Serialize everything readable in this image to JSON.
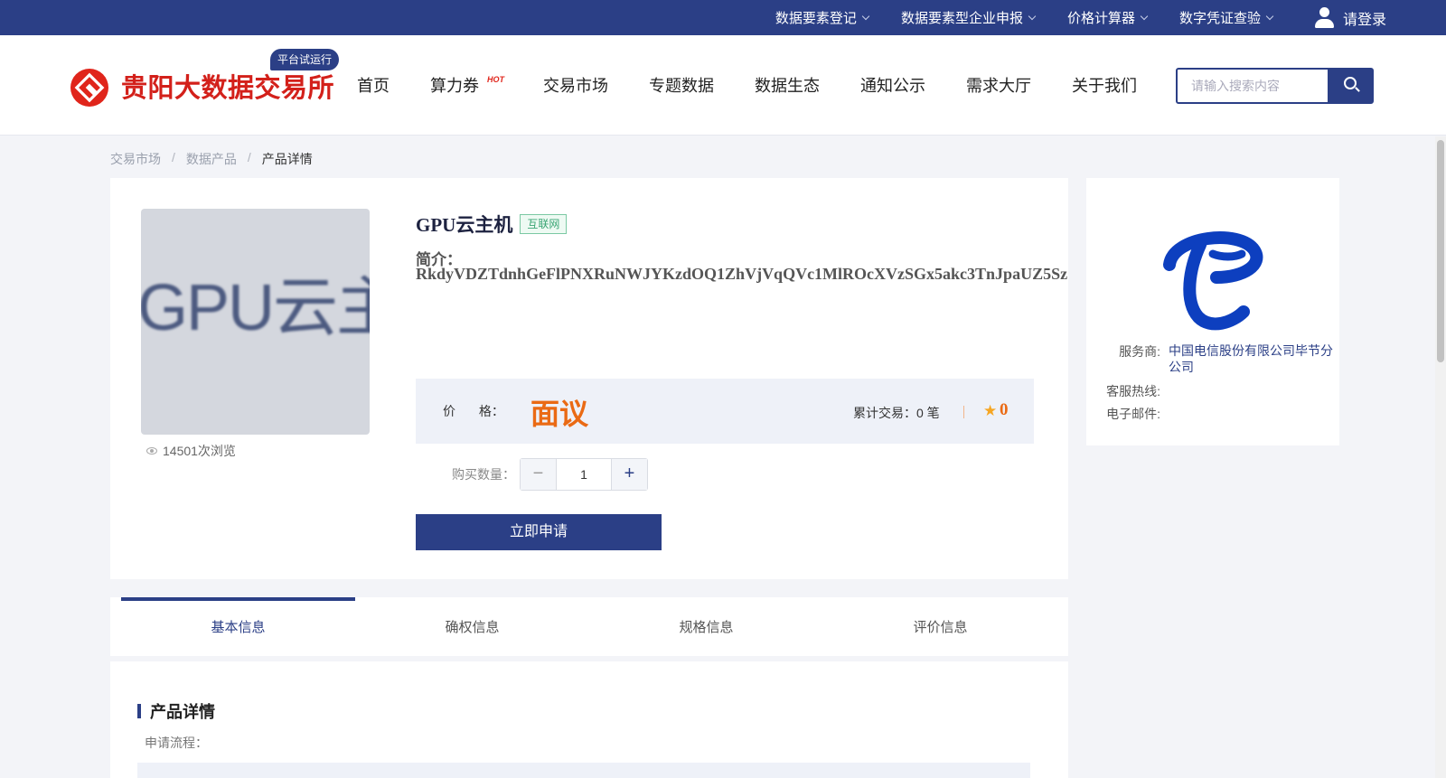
{
  "topbar": {
    "links": [
      "数据要素登记",
      "数据要素型企业申报",
      "价格计算器",
      "数字凭证查验"
    ],
    "login": "请登录"
  },
  "header": {
    "logo_text": "贵阳大数据交易所",
    "trial_badge": "平台试运行",
    "nav": [
      "首页",
      "算力券",
      "交易市场",
      "专题数据",
      "数据生态",
      "通知公示",
      "需求大厅",
      "关于我们"
    ],
    "hot_tag": "HOT",
    "search_placeholder": "请输入搜索内容"
  },
  "breadcrumb": [
    "交易市场",
    "数据产品",
    "产品详情"
  ],
  "product": {
    "image_text": "GPU云主机",
    "views": "14501次浏览",
    "title": "GPU云主机",
    "tag": "互联网",
    "intro_label": "简介：",
    "intro_text": "RkdyVDZTdnhGeFlPNXRuNWJYKzdOQ1ZhVjVqQVc1MlROcXVzSGx5akc3TnJpaUZ5Sz",
    "price_label": "价 格：",
    "price_value": "面议",
    "trade_count": "累计交易：0 笔",
    "rating": "0",
    "qty_label": "购买数量：",
    "qty_value": "1",
    "apply_button": "立即申请"
  },
  "provider": {
    "service_label": "服务商:",
    "service_value": "中国电信股份有限公司毕节分公司",
    "hotline_label": "客服热线:",
    "hotline_value": "",
    "email_label": "电子邮件:",
    "email_value": ""
  },
  "tabs": [
    "基本信息",
    "确权信息",
    "规格信息",
    "评价信息"
  ],
  "active_tab": 0,
  "details": {
    "section_title": "产品详情",
    "flow_label": "申请流程："
  },
  "colors": {
    "brand_blue": "#2b3f86",
    "logo_red": "#d3201a",
    "price_orange": "#ea6a14",
    "telecom_blue": "#0d3fbf"
  }
}
